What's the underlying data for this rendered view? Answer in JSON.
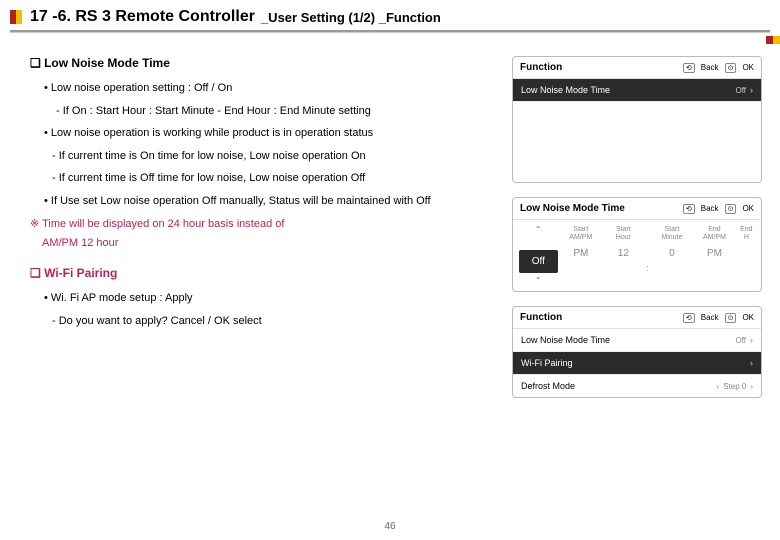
{
  "header": {
    "title_main": "17 -6. RS 3 Remote Controller",
    "title_sub": "_User Setting (1/2) _Function"
  },
  "section_low_noise": {
    "title": "❑ Low Noise Mode Time",
    "lines": [
      "• Low noise operation setting : Off / On",
      "-  If On : Start Hour : Start Minute - End Hour : End Minute setting",
      "• Low noise operation is working while product is in operation status",
      "- If current time is On time for low noise, Low noise operation On",
      "- If current time is Off time for low noise, Low noise operation Off",
      "• If Use set Low noise operation Off manually, Status will be maintained with Off"
    ],
    "note_line1": "※ Time will be displayed on 24 hour basis instead of",
    "note_line2": "AM/PM 12 hour"
  },
  "section_wifi": {
    "title": "❑ Wi-Fi Pairing",
    "line1": "• Wi. Fi AP mode setup : Apply",
    "line2": "- Do you want to apply? Cancel / OK select"
  },
  "panels": {
    "p1": {
      "header": "Function",
      "back": "Back",
      "ok": "OK",
      "row_label": "Low Noise Mode Time",
      "row_value": "Off"
    },
    "p2": {
      "header": "Low Noise Mode Time",
      "back": "Back",
      "ok": "OK",
      "cols": {
        "c0_val": "Off",
        "c1_lab1": "Start",
        "c1_lab2": "AM/PM",
        "c1_val": "PM",
        "c2_lab1": "Start",
        "c2_lab2": "Hour",
        "c2_val": "12",
        "c3_lab1": "Start",
        "c3_lab2": "Minute",
        "c3_val": "0",
        "c4_lab1": "End",
        "c4_lab2": "AM/PM",
        "c4_val": "PM",
        "c5_lab1": "End",
        "c5_lab2": "H"
      }
    },
    "p3": {
      "header": "Function",
      "back": "Back",
      "ok": "OK",
      "r1_label": "Low Noise Mode Time",
      "r1_value": "Off",
      "r2_label": "Wi-Fi Pairing",
      "r3_label": "Defrost Mode",
      "r3_value": "Step 0"
    }
  },
  "page_number": "46"
}
